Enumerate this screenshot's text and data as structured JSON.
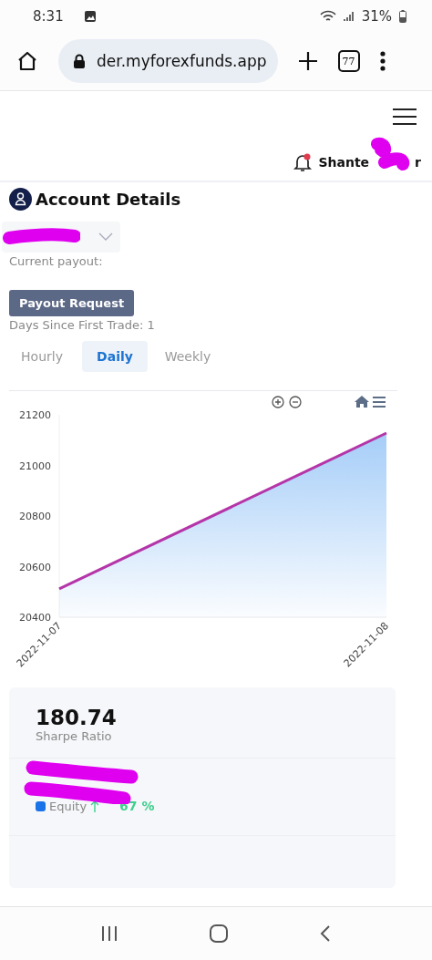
{
  "status_bar": {
    "time": "8:31",
    "battery": "31%"
  },
  "browser": {
    "url": "der.myforexfunds.app",
    "tab_count": "77"
  },
  "header": {
    "user_name": "Shante",
    "user_name_end": "r",
    "notification": true
  },
  "page_title": "Account Details",
  "payout": {
    "label": "Current payout:",
    "button": "Payout Request",
    "days": "Days Since First Trade: 1"
  },
  "tabs": [
    {
      "label": "Hourly",
      "selected": false
    },
    {
      "label": "Daily",
      "selected": true
    },
    {
      "label": "Weekly",
      "selected": false
    }
  ],
  "chart_data": {
    "type": "area",
    "x": [
      "2022-11-07",
      "2022-11-08"
    ],
    "series": [
      {
        "name": "Equity",
        "color": "#b535a8",
        "values": [
          20512,
          21128
        ]
      }
    ],
    "ylim": [
      20400,
      21200
    ],
    "yticks": [
      20400,
      20600,
      20800,
      21000,
      21200
    ]
  },
  "stats": [
    {
      "value": "180.74",
      "label": "Sharpe Ratio"
    }
  ],
  "equity": {
    "change": "67 %",
    "color": "#1a73e8"
  }
}
